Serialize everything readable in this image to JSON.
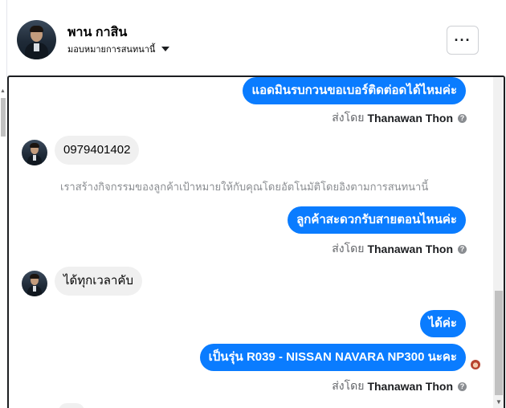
{
  "header": {
    "name": "พาน กาสิน",
    "assign_label": "มอบหมายการสนทนานี้",
    "more_label": "···"
  },
  "messages": {
    "out1": "แอดมินรบกวนขอเบอร์ติดต่อดได้ไหมค่ะ",
    "in1": "0979401402",
    "system_note": "เราสร้างกิจกรรมของลูกค้าเป้าหมายให้กับคุณโดยอัตโนมัติโดยอิงตามการสนทนานี้",
    "out2": "ลูกค้าสะดวกรับสายตอนไหนค่ะ",
    "in2": "ได้ทุกเวลาคับ",
    "out3": "ได้ค่ะ",
    "out4": "เป็นรุ่น R039 - NISSAN NAVARA NP300 นะคะ"
  },
  "sent_by": {
    "prefix": "ส่งโดย",
    "agent": "Thanawan Thon",
    "help_icon": "?"
  },
  "colors": {
    "outgoing_bubble": "#0a7cff",
    "incoming_bubble": "#f0f0f0",
    "muted_text": "#65676b"
  },
  "icons": {
    "more": "ellipsis-icon",
    "dropdown": "caret-down-icon",
    "help": "question-circle-icon"
  }
}
